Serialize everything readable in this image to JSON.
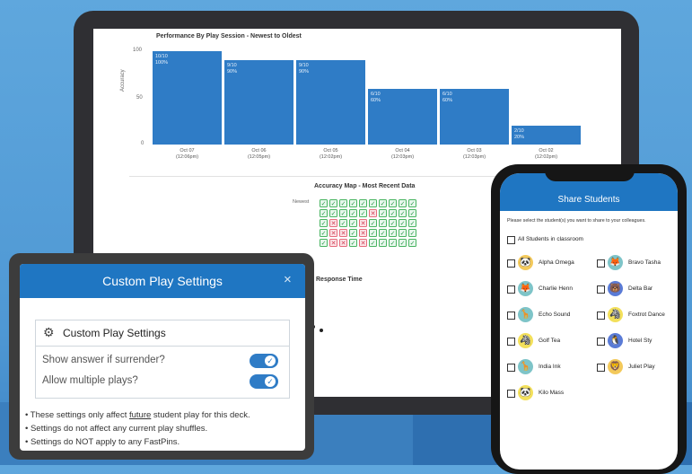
{
  "performance_chart": {
    "title": "Performance By Play Session - Newest to Oldest",
    "ylabel": "Accuracy",
    "y_ticks": [
      "100",
      "50",
      "0"
    ],
    "bars": [
      {
        "score": "10/10",
        "pct": "100%",
        "value": 100,
        "date": "Oct 07",
        "time": "(12:06pm)"
      },
      {
        "score": "9/10",
        "pct": "90%",
        "value": 90,
        "date": "Oct 06",
        "time": "(12:05pm)"
      },
      {
        "score": "9/10",
        "pct": "90%",
        "value": 90,
        "date": "Oct 05",
        "time": "(12:02pm)"
      },
      {
        "score": "6/10",
        "pct": "60%",
        "value": 60,
        "date": "Oct 04",
        "time": "(12:03pm)"
      },
      {
        "score": "6/10",
        "pct": "60%",
        "value": 60,
        "date": "Oct 03",
        "time": "(12:03pm)"
      },
      {
        "score": "2/10",
        "pct": "20%",
        "value": 20,
        "date": "Oct 02",
        "time": "(12:02pm)"
      }
    ]
  },
  "accuracy_map": {
    "title": "Accuracy Map - Most Recent Data",
    "newest_label": "Newest",
    "rows": [
      [
        "ok",
        "ok",
        "ok",
        "ok",
        "ok",
        "ok",
        "ok",
        "ok",
        "ok",
        "ok"
      ],
      [
        "ok",
        "ok",
        "ok",
        "ok",
        "ok",
        "bad",
        "ok",
        "ok",
        "ok",
        "ok"
      ],
      [
        "ok",
        "bad",
        "ok",
        "ok",
        "bad",
        "ok",
        "ok",
        "ok",
        "ok",
        "ok"
      ],
      [
        "ok",
        "bad",
        "bad",
        "ok",
        "bad",
        "ok",
        "ok",
        "ok",
        "ok",
        "ok"
      ],
      [
        "ok",
        "bad",
        "bad",
        "ok",
        "bad",
        "ok",
        "ok",
        "ok",
        "ok",
        "ok"
      ]
    ]
  },
  "response_time": {
    "title": "Response Time"
  },
  "share_students": {
    "title": "Share Students",
    "description": "Please select the student(s) you want to share to your colleagues.",
    "all_label": "All Students in classroom",
    "students": [
      {
        "name": "Alpha Omega",
        "icon": "panda-icon",
        "glyph": "🐼",
        "color": "#f3c95b"
      },
      {
        "name": "Bravo Tasha",
        "icon": "fox-icon",
        "glyph": "🦊",
        "color": "#7ec4c8"
      },
      {
        "name": "Charlie Henn",
        "icon": "fox-icon",
        "glyph": "🦊",
        "color": "#7ec4c8"
      },
      {
        "name": "Delta Bar",
        "icon": "bear-icon",
        "glyph": "🐻",
        "color": "#5a7bd6"
      },
      {
        "name": "Echo Sound",
        "icon": "giraffe-icon",
        "glyph": "🦒",
        "color": "#7ec4c8"
      },
      {
        "name": "Foxtrot Dance",
        "icon": "zebra-icon",
        "glyph": "🦓",
        "color": "#f3e05b"
      },
      {
        "name": "Golf Tea",
        "icon": "zebra-icon",
        "glyph": "🦓",
        "color": "#f3e05b"
      },
      {
        "name": "Hotel Sty",
        "icon": "penguin-icon",
        "glyph": "🐧",
        "color": "#5a7bd6"
      },
      {
        "name": "India Ink",
        "icon": "giraffe-icon",
        "glyph": "🦒",
        "color": "#7ec4c8"
      },
      {
        "name": "Juliet Play",
        "icon": "lion-icon",
        "glyph": "🦁",
        "color": "#f3c95b"
      },
      {
        "name": "Kilo Mass",
        "icon": "panda-icon",
        "glyph": "🐼",
        "color": "#f3e05b"
      }
    ]
  },
  "custom_play_settings": {
    "modal_title": "Custom Play Settings",
    "close_symbol": "×",
    "panel_title": "Custom Play Settings",
    "options": [
      {
        "label": "Show answer if surrender?",
        "enabled": true
      },
      {
        "label": "Allow multiple plays?",
        "enabled": true
      }
    ],
    "notes": {
      "n1_before": "These settings only affect ",
      "n1_emph": "future",
      "n1_after": " student play for this deck.",
      "n2": "Settings do not affect any current play shuffles.",
      "n3": "Settings do NOT apply to any FastPins."
    }
  },
  "colors": {
    "accent": "#1f76c2",
    "bar": "#2f7cc6",
    "correct": "#48b461",
    "incorrect": "#e46b7b"
  }
}
